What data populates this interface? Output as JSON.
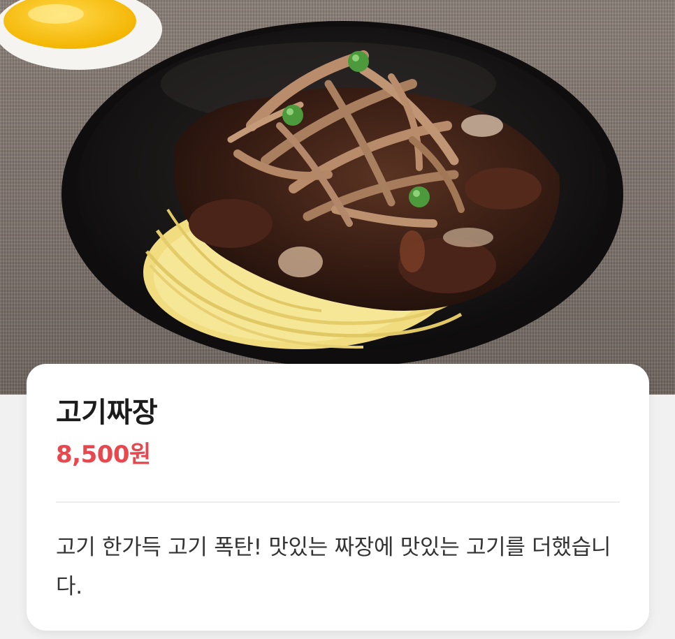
{
  "menu_item": {
    "name": "고기짜장",
    "price": "8,500원",
    "description": "고기 한가득 고기 폭탄! 맛있는 짜장에 맛있는 고기를 더했습니다."
  },
  "photo": {
    "subject_icon": "jjajangmyeon-bowl-image",
    "side_dish_icon": "pickled-radish-dish-image"
  },
  "colors": {
    "price": "#e8484d",
    "title": "#1c1c1c",
    "description": "#333333",
    "card_background": "#ffffff",
    "page_background": "#f1f1f1"
  }
}
